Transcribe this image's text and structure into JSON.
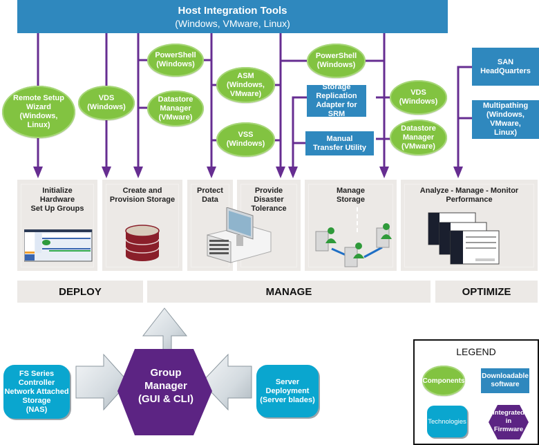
{
  "header": {
    "title": "Host Integration Tools",
    "subtitle": "(Windows, VMware, Linux)"
  },
  "components": [
    {
      "id": "remote-setup-wizard",
      "label": "Remote Setup Wizard (Windows, Linux)",
      "lines": [
        "Remote Setup",
        "Wizard",
        "(Windows,",
        "Linux)"
      ]
    },
    {
      "id": "vds-1",
      "label": "VDS (Windows)",
      "lines": [
        "VDS",
        "(Windows)"
      ]
    },
    {
      "id": "powershell-1",
      "label": "PowerShell (Windows)",
      "lines": [
        "PowerShell",
        "(Windows)"
      ]
    },
    {
      "id": "datastore-manager-1",
      "label": "Datastore Manager (VMware)",
      "lines": [
        "Datastore",
        "Manager",
        "(VMware)"
      ]
    },
    {
      "id": "asm",
      "label": "ASM (Windows, VMware)",
      "lines": [
        "ASM",
        "(Windows,",
        "VMware)"
      ]
    },
    {
      "id": "vss",
      "label": "VSS (Windows)",
      "lines": [
        "VSS",
        "(Windows)"
      ]
    },
    {
      "id": "powershell-2",
      "label": "PowerShell (Windows)",
      "lines": [
        "PowerShell",
        "(Windows)"
      ]
    },
    {
      "id": "vds-2",
      "label": "VDS (Windows)",
      "lines": [
        "VDS",
        "(Windows)"
      ]
    },
    {
      "id": "datastore-manager-2",
      "label": "Datastore Manager (VMware)",
      "lines": [
        "Datastore",
        "Manager",
        "(VMware)"
      ]
    }
  ],
  "downloadable_software": [
    {
      "id": "srm-adapter",
      "lines": [
        "Storage",
        "Replication",
        "Adapter for SRM"
      ]
    },
    {
      "id": "manual-transfer-utility",
      "lines": [
        "Manual",
        "Transfer Utility"
      ]
    },
    {
      "id": "san-headquarters",
      "lines": [
        "SAN",
        "HeadQuarters"
      ]
    },
    {
      "id": "multipathing",
      "lines": [
        "Multipathing",
        "(Windows,",
        "VMware,",
        "Linux)"
      ]
    }
  ],
  "tasks": [
    {
      "id": "initialize-hardware",
      "lines": [
        "Initialize",
        "Hardware",
        "Set Up Groups"
      ],
      "image": "gui-screenshot"
    },
    {
      "id": "create-provision-storage",
      "lines": [
        "Create and",
        "Provision Storage"
      ],
      "image": "database-cylinder"
    },
    {
      "id": "protect-data",
      "lines": [
        "Protect",
        "Data"
      ],
      "image": "storage-array-monitor"
    },
    {
      "id": "provide-disaster-tolerance",
      "lines": [
        "Provide",
        "Disaster",
        "Tolerance"
      ],
      "image": ""
    },
    {
      "id": "manage-storage",
      "lines": [
        "Manage",
        "Storage"
      ],
      "image": "networked-users"
    },
    {
      "id": "analyze-manage-monitor",
      "lines": [
        "Analyze - Manage - Monitor",
        "Performance"
      ],
      "image": "stacked-dialogs"
    }
  ],
  "phases": [
    "DEPLOY",
    "MANAGE",
    "OPTIMIZE"
  ],
  "core": {
    "lines": [
      "Group",
      "Manager",
      "(GUI & CLI)"
    ]
  },
  "technologies": [
    {
      "id": "fs-series-nas",
      "lines": [
        "FS Series",
        "Controller",
        "Network Attached",
        "Storage",
        "(NAS)"
      ]
    },
    {
      "id": "server-deployment",
      "lines": [
        "Server",
        "Deployment",
        "(Server blades)"
      ]
    }
  ],
  "legend": {
    "title": "LEGEND",
    "items": [
      {
        "type": "component",
        "label": "Components"
      },
      {
        "type": "downloadable",
        "lines": [
          "Downloadable",
          "software"
        ]
      },
      {
        "type": "technology",
        "label": "Technologies"
      },
      {
        "type": "firmware",
        "lines": [
          "Integrated",
          "in",
          "Firmware"
        ]
      }
    ]
  },
  "colors": {
    "component_green": "#82c341",
    "software_blue": "#2f88be",
    "technology_cyan": "#0aa6cf",
    "firmware_purple": "#5c2483",
    "connector_purple": "#662d91",
    "panel_gray": "#ece9e6"
  }
}
